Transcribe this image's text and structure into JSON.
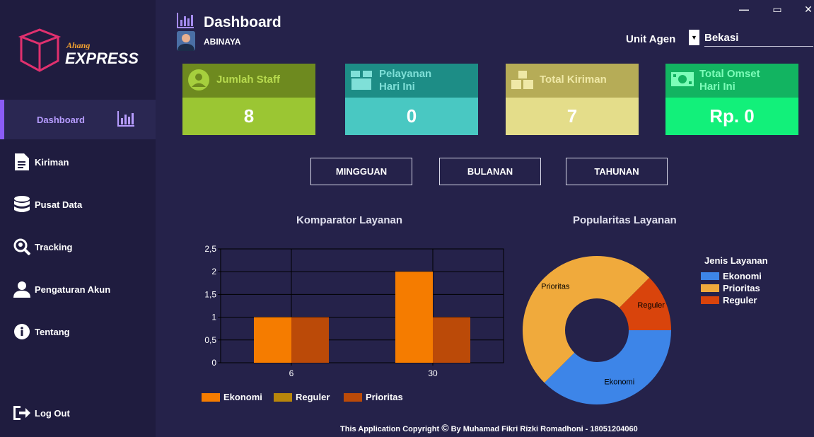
{
  "app": {
    "brand_small": "Ahang",
    "brand_large": "EXPRESS"
  },
  "header": {
    "title": "Dashboard",
    "user_name": "ABINAYA",
    "unit_label": "Unit Agen",
    "unit_value": "Bekasi"
  },
  "window_controls": {
    "minimize": "—",
    "maximize": "▭",
    "close": "✕"
  },
  "sidebar": {
    "items": [
      {
        "label": "Dashboard",
        "icon": "bar-chart-icon",
        "active": true
      },
      {
        "label": "Kiriman",
        "icon": "document-icon"
      },
      {
        "label": "Pusat Data",
        "icon": "database-icon"
      },
      {
        "label": "Tracking",
        "icon": "location-search-icon"
      },
      {
        "label": "Pengaturan Akun",
        "icon": "user-icon"
      },
      {
        "label": "Tentang",
        "icon": "info-icon"
      }
    ],
    "logout": {
      "label": "Log Out",
      "icon": "logout-icon"
    }
  },
  "cards": [
    {
      "title": "Jumlah Staff",
      "value": "8",
      "icon": "user-circle-icon"
    },
    {
      "title_line1": "Pelayanan",
      "title_line2": "Hari Ini",
      "value": "0",
      "icon": "box-icon"
    },
    {
      "title": "Total Kiriman",
      "value": "7",
      "icon": "boxes-icon"
    },
    {
      "title_line1": "Total Omset",
      "title_line2": "Hari Ini",
      "value": "Rp. 0",
      "icon": "money-icon"
    }
  ],
  "period_buttons": [
    "MINGGUAN",
    "BULANAN",
    "TAHUNAN"
  ],
  "colors": {
    "ekonomi": "#f57c00",
    "reguler_bar": "#bb4a08",
    "reguler_legend": "#b8860b",
    "prioritas_legend": "#bb4a08",
    "pie_ekonomi": "#3d85e8",
    "pie_prioritas": "#f0aa3c",
    "pie_reguler": "#d9440c"
  },
  "chart_data": [
    {
      "type": "bar",
      "title": "Komparator Layanan",
      "categories": [
        "6",
        "30"
      ],
      "series": [
        {
          "name": "Ekonomi",
          "values": [
            1,
            2
          ]
        },
        {
          "name": "Prioritas",
          "values": [
            1,
            1
          ]
        }
      ],
      "legend": [
        "Ekonomi",
        "Reguler",
        "Prioritas"
      ],
      "ylim": [
        0,
        2.5
      ],
      "yticks": [
        "0",
        "0,5",
        "1",
        "1,5",
        "2",
        "2,5"
      ],
      "grid": true,
      "legend_position": "bottom"
    },
    {
      "type": "pie",
      "title": "Popularitas Layanan",
      "legend_title": "Jenis Layanan",
      "slices": [
        {
          "name": "Ekonomi",
          "value": 37.5
        },
        {
          "name": "Prioritas",
          "value": 50
        },
        {
          "name": "Reguler",
          "value": 12.5
        }
      ],
      "legend": [
        "Ekonomi",
        "Prioritas",
        "Reguler"
      ],
      "legend_position": "right"
    }
  ],
  "footer": {
    "text_before": "This Application Copyright",
    "symbol": "©",
    "text_after": " By Muhamad Fikri Rizki Romadhoni - 18051204060"
  }
}
